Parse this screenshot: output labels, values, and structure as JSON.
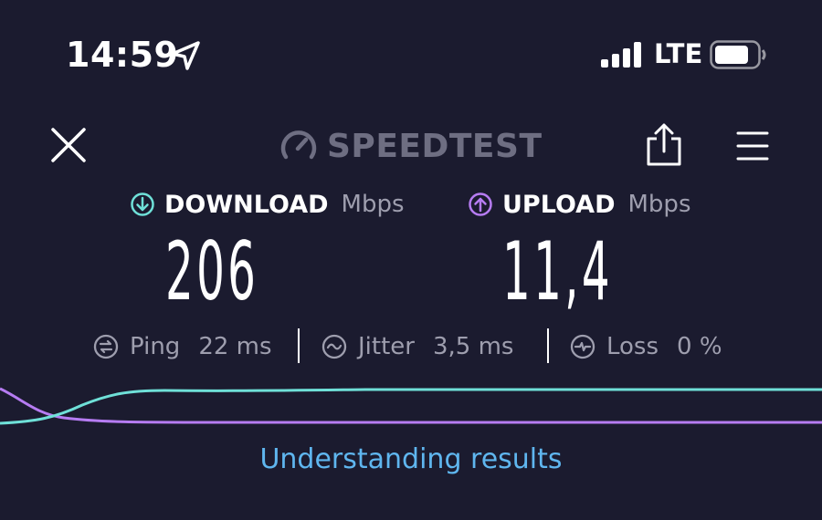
{
  "status_bar": {
    "time": "14:59",
    "network": "LTE",
    "icons": [
      "location-arrow-icon",
      "cellular-signal-icon",
      "battery-icon"
    ]
  },
  "header": {
    "brand": "SPEEDTEST",
    "icons": [
      "close-icon",
      "speedometer-icon",
      "share-icon",
      "menu-icon"
    ]
  },
  "download": {
    "label": "DOWNLOAD",
    "unit": "Mbps",
    "value": "206",
    "color": "#6fe0d8"
  },
  "upload": {
    "label": "UPLOAD",
    "unit": "Mbps",
    "value": "11,4",
    "color": "#b67cf2"
  },
  "stats": {
    "ping": {
      "label": "Ping",
      "value": "22 ms"
    },
    "jitter": {
      "label": "Jitter",
      "value": "3,5 ms"
    },
    "loss": {
      "label": "Loss",
      "value": "0 %"
    }
  },
  "link_text": "Understanding results",
  "colors": {
    "background": "#1b1b2f",
    "muted_text": "#9e9eae",
    "brand_gray": "#6e6e82",
    "link": "#5fb6ef"
  }
}
